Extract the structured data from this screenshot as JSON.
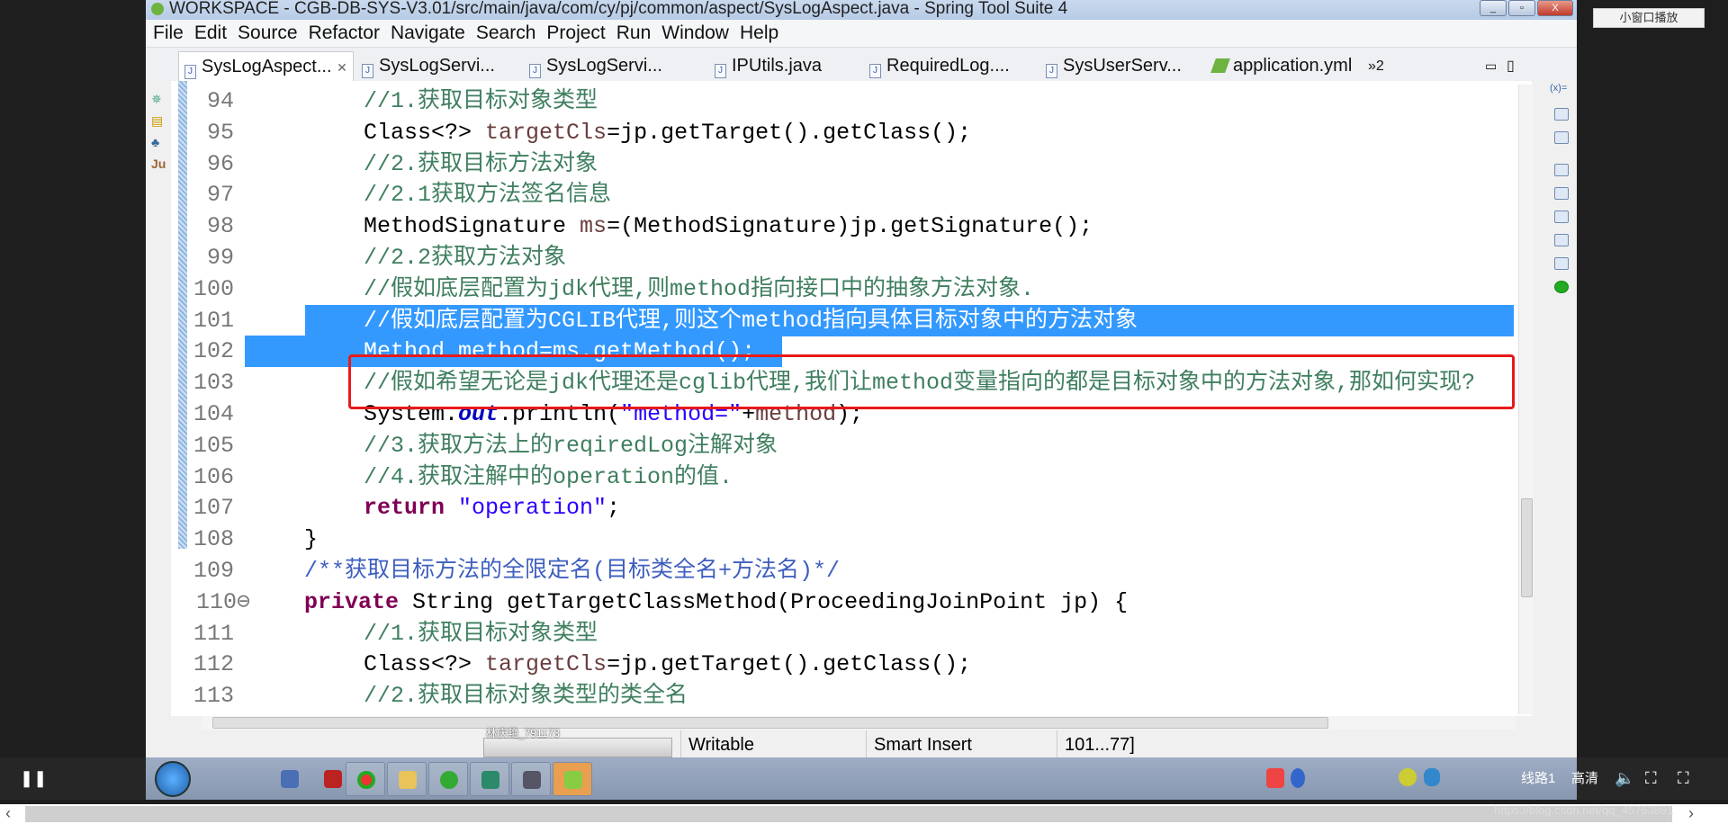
{
  "window": {
    "title": "WORKSPACE - CGB-DB-SYS-V3.01/src/main/java/com/cy/pj/common/aspect/SysLogAspect.java - Spring Tool Suite 4"
  },
  "menu": [
    "File",
    "Edit",
    "Source",
    "Refactor",
    "Navigate",
    "Search",
    "Project",
    "Run",
    "Window",
    "Help"
  ],
  "tabs": [
    {
      "label": "SysLogAspect...",
      "icon": "java-file-icon",
      "active": true
    },
    {
      "label": "SysLogServi...",
      "icon": "java-file-icon"
    },
    {
      "label": "SysLogServi...",
      "icon": "java-file-icon"
    },
    {
      "label": "IPUtils.java",
      "icon": "java-file-icon"
    },
    {
      "label": "RequiredLog....",
      "icon": "java-file-icon"
    },
    {
      "label": "SysUserServ...",
      "icon": "java-file-icon"
    },
    {
      "label": "application.yml",
      "icon": "yaml-file-icon"
    }
  ],
  "tabs_overflow": "»2",
  "code_colors": {
    "comment": "#3f7f5f",
    "keyword": "#7f0055",
    "string": "#2a00ff",
    "field": "#0000c0",
    "local": "#6a3e3e",
    "javadoc": "#3f5fbf",
    "plain": "#000000",
    "selected": "#ffffff"
  },
  "code": [
    {
      "n": "94",
      "lv": 2,
      "t": [
        [
          "//1.获取目标对象类型",
          "comment"
        ]
      ]
    },
    {
      "n": "95",
      "lv": 2,
      "t": [
        [
          "Class<?> ",
          "plain"
        ],
        [
          "targetCls",
          "local"
        ],
        [
          "=jp.getTarget().getClass();",
          "plain"
        ]
      ]
    },
    {
      "n": "96",
      "lv": 2,
      "t": [
        [
          "//2.获取目标方法对象",
          "comment"
        ]
      ]
    },
    {
      "n": "97",
      "lv": 2,
      "t": [
        [
          "//2.1获取方法签名信息",
          "comment"
        ]
      ]
    },
    {
      "n": "98",
      "lv": 2,
      "t": [
        [
          "MethodSignature ",
          "plain"
        ],
        [
          "ms",
          "local"
        ],
        [
          "=(MethodSignature)jp.getSignature();",
          "plain"
        ]
      ]
    },
    {
      "n": "99",
      "lv": 2,
      "t": [
        [
          "//2.2获取方法对象",
          "comment"
        ]
      ]
    },
    {
      "n": "100",
      "lv": 2,
      "t": [
        [
          "//假如底层配置为jdk代理,则method指向接口中的抽象方法对象.",
          "comment"
        ]
      ]
    },
    {
      "n": "101",
      "lv": 2,
      "sel": true,
      "t": [
        [
          "//假如底层配置为CGLIB代理,则这个method指向具体目标对象中的方法对象",
          "selected"
        ]
      ]
    },
    {
      "n": "102",
      "lv": 2,
      "sel": true,
      "t": [
        [
          "Method method=ms.getMethod();",
          "selected"
        ]
      ]
    },
    {
      "n": "103",
      "lv": 2,
      "t": [
        [
          "//假如希望无论是jdk代理还是cglib代理,我们让method变量指向的都是目标对象中的方法对象,那如何实现?",
          "comment"
        ]
      ]
    },
    {
      "n": "104",
      "lv": 2,
      "t": [
        [
          "System.",
          "plain"
        ],
        [
          "out",
          "field"
        ],
        [
          ".println(",
          "plain"
        ],
        [
          "\"method=\"",
          "string"
        ],
        [
          "+",
          "plain"
        ],
        [
          "method",
          "local"
        ],
        [
          ");",
          "plain"
        ]
      ]
    },
    {
      "n": "105",
      "lv": 2,
      "t": [
        [
          "//3.获取方法上的reqiredLog注解对象",
          "comment"
        ]
      ]
    },
    {
      "n": "106",
      "lv": 2,
      "t": [
        [
          "//4.获取注解中的operation的值.",
          "comment"
        ]
      ]
    },
    {
      "n": "107",
      "lv": 2,
      "t": [
        [
          "return ",
          "keyword"
        ],
        [
          "\"operation\"",
          "string"
        ],
        [
          ";",
          "plain"
        ]
      ]
    },
    {
      "n": "108",
      "lv": 1,
      "t": [
        [
          "}",
          "plain"
        ]
      ]
    },
    {
      "n": "109",
      "lv": 1,
      "t": [
        [
          "/**获取目标方法的全限定名(目标类全名+方法名)*/",
          "javadoc"
        ]
      ]
    },
    {
      "n": "110",
      "lv": 1,
      "fold": true,
      "t": [
        [
          "private ",
          "keyword"
        ],
        [
          "String getTargetClassMethod(ProceedingJoinPoint jp) {",
          "plain"
        ]
      ]
    },
    {
      "n": "111",
      "lv": 2,
      "t": [
        [
          "//1.获取目标对象类型",
          "comment"
        ]
      ]
    },
    {
      "n": "112",
      "lv": 2,
      "t": [
        [
          "Class<?> ",
          "plain"
        ],
        [
          "targetCls",
          "local"
        ],
        [
          "=jp.getTarget().getClass();",
          "plain"
        ]
      ]
    },
    {
      "n": "113",
      "lv": 2,
      "t": [
        [
          "//2.获取目标对象类型的类全名",
          "comment"
        ]
      ]
    }
  ],
  "status": {
    "progress_label": "林庆艳_791173",
    "writable": "Writable",
    "insert_mode": "Smart Insert",
    "position": "101...77]"
  },
  "player": {
    "small_window": "小窗口播放",
    "line": "线路1",
    "quality": "高清",
    "watermark": "https://blog.csdn.net/qq_45763891"
  },
  "accent": "#3399ff",
  "highlight_box": "#e8191a"
}
